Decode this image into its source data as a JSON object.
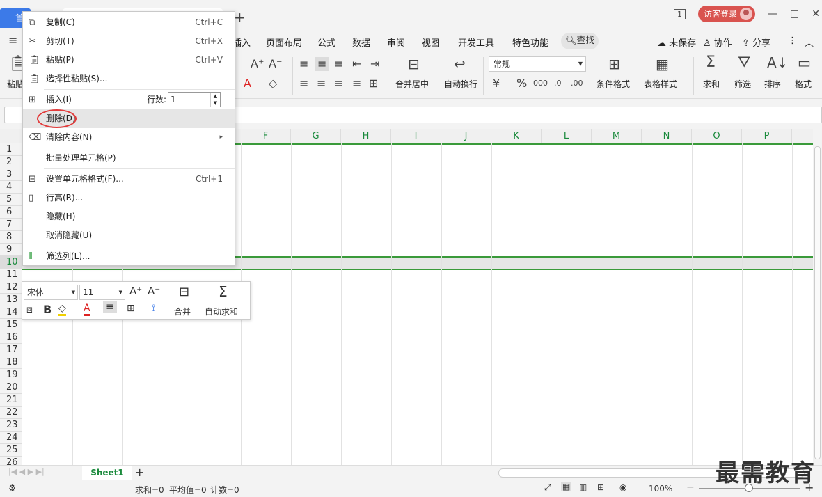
{
  "window": {
    "home_tab": "首",
    "login": "访客登录",
    "page_indicator": "1",
    "minimize": "—",
    "restore": "□",
    "close": "✕"
  },
  "menubar": {
    "hamburger": "≡",
    "items": [
      "插入",
      "页面布局",
      "公式",
      "数据",
      "审阅",
      "视图",
      "开发工具",
      "特色功能"
    ],
    "search": "查找",
    "unsaved": "未保存",
    "collab": "协作",
    "share": "分享"
  },
  "ribbon": {
    "paste": "粘贴",
    "merge_center": "合并居中",
    "wrap_text": "自动换行",
    "number_format": "常规",
    "cond_format": "条件格式",
    "table_style": "表格样式",
    "sum": "求和",
    "filter": "筛选",
    "sort": "排序",
    "format": "格式"
  },
  "grid": {
    "columns": [
      "F",
      "G",
      "H",
      "I",
      "J",
      "K",
      "L",
      "M",
      "N",
      "O",
      "P"
    ],
    "rows": [
      "1",
      "2",
      "3",
      "4",
      "5",
      "6",
      "7",
      "8",
      "9",
      "10",
      "11",
      "12",
      "13",
      "14",
      "15",
      "16",
      "17",
      "18",
      "19",
      "20",
      "21",
      "22",
      "23",
      "24",
      "25",
      "26"
    ],
    "selected_row": "10"
  },
  "context_menu": {
    "copy": {
      "label": "复制(C)",
      "shortcut": "Ctrl+C"
    },
    "cut": {
      "label": "剪切(T)",
      "shortcut": "Ctrl+X"
    },
    "paste": {
      "label": "粘贴(P)",
      "shortcut": "Ctrl+V"
    },
    "paste_special": {
      "label": "选择性粘贴(S)..."
    },
    "insert": {
      "label": "插入(I)",
      "rows_label": "行数:",
      "rows_value": "1"
    },
    "delete": {
      "label": "删除(D)"
    },
    "clear": {
      "label": "清除内容(N)"
    },
    "batch": {
      "label": "批量处理单元格(P)"
    },
    "format_cells": {
      "label": "设置单元格格式(F)...",
      "shortcut": "Ctrl+1"
    },
    "row_height": {
      "label": "行高(R)..."
    },
    "hide": {
      "label": "隐藏(H)"
    },
    "unhide": {
      "label": "取消隐藏(U)"
    },
    "filter_col": {
      "label": "筛选列(L)..."
    }
  },
  "mini_toolbar": {
    "font": "宋体",
    "size": "11",
    "merge": "合并",
    "autosum": "自动求和"
  },
  "sheets": {
    "active": "Sheet1"
  },
  "status": {
    "sum": "求和=0",
    "avg": "平均值=0",
    "count": "计数=0",
    "zoom": "100%"
  },
  "watermark": "最需教育",
  "colors": {
    "accent": "#3c7ae8",
    "grid_green": "#1a8a3c",
    "highlight_red": "#e23b3b"
  }
}
